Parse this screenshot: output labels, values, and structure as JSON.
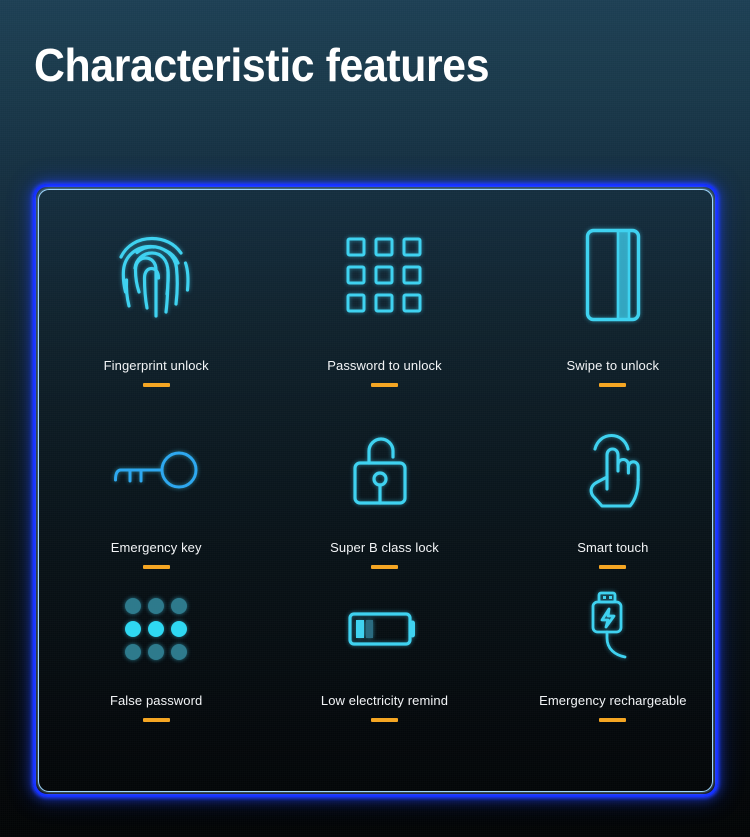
{
  "page": {
    "title": "Characteristic features",
    "background_top_color": "#1e4055",
    "background_bottom_color": "#030506",
    "panel_border_color": "#1430ff",
    "panel_inner_line_color": "#9fd8ff",
    "accent_color": "#f5a623",
    "icon_color": "#3fd2f0",
    "icon_dim_color": "#2e7a8c",
    "label_color": "#f2f4f6"
  },
  "features": [
    {
      "id": "fingerprint-unlock",
      "label": "Fingerprint unlock",
      "icon": "fingerprint-icon",
      "row": 1,
      "column": 1
    },
    {
      "id": "password-to-unlock",
      "label": "Password to unlock",
      "icon": "keypad-grid-icon",
      "row": 1,
      "column": 2
    },
    {
      "id": "swipe-to-unlock",
      "label": "Swipe to unlock",
      "icon": "swipe-card-icon",
      "row": 1,
      "column": 3
    },
    {
      "id": "emergency-key",
      "label": "Emergency key",
      "icon": "key-icon",
      "row": 2,
      "column": 1
    },
    {
      "id": "super-b-class-lock",
      "label": "Super B class lock",
      "icon": "open-padlock-icon",
      "row": 2,
      "column": 2
    },
    {
      "id": "smart-touch",
      "label": "Smart touch",
      "icon": "touch-hand-icon",
      "row": 2,
      "column": 3
    },
    {
      "id": "false-password",
      "label": "False password",
      "icon": "dot-grid-icon",
      "row": 3,
      "column": 1
    },
    {
      "id": "low-electricity-remind",
      "label": "Low electricity remind",
      "icon": "low-battery-icon",
      "row": 3,
      "column": 2
    },
    {
      "id": "emergency-rechargeable",
      "label": "Emergency rechargeable",
      "icon": "usb-charger-icon",
      "row": 3,
      "column": 3
    }
  ]
}
